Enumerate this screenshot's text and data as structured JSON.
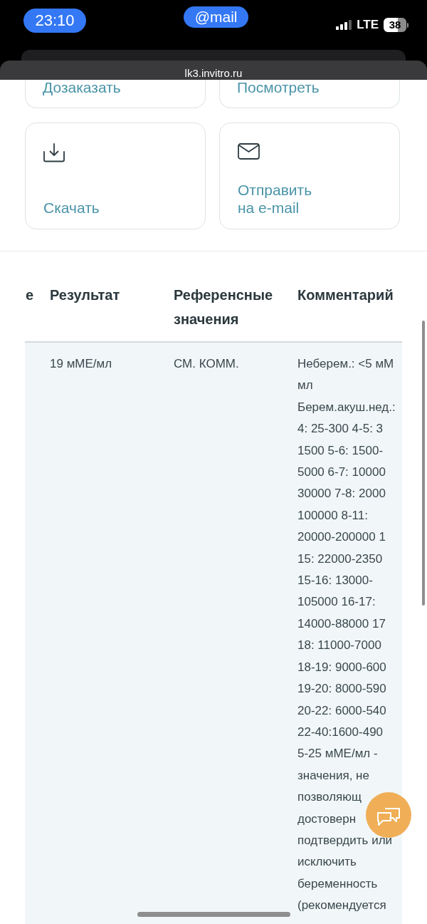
{
  "status_bar": {
    "time": "23:10",
    "app_pill": "@mail",
    "network": "LTE",
    "battery": "38"
  },
  "browser": {
    "url": "lk3.invitro.ru"
  },
  "action_rows": [
    {
      "cut_off": true,
      "items": [
        {
          "label": "Дозаказать"
        },
        {
          "label": "Посмотреть"
        }
      ]
    },
    {
      "cut_off": false,
      "items": [
        {
          "label": "Скачать",
          "kind": "download"
        },
        {
          "label": "Отправить на e-mail",
          "kind": "email"
        }
      ]
    }
  ],
  "table": {
    "columns": [
      "е",
      "Результат",
      "Референсные значения",
      "Комментарий"
    ],
    "rows": [
      {
        "result": "19 мМЕ/мл",
        "reference": "СМ. КОММ.",
        "comment_lines": [
          "Неберем.: <5 мМ",
          "мл",
          "Берем.акуш.нед.:",
          "4: 25-300 4-5: 3",
          "1500 5-6: 1500-",
          "5000 6-7: 10000",
          "30000 7-8: 2000",
          "100000 8-11:",
          "20000-200000 1",
          "15: 22000-2350",
          "15-16: 13000-",
          "105000 16-17:",
          "14000-88000 17",
          "18: 11000-7000",
          "18-19: 9000-600",
          "19-20: 8000-590",
          "20-22: 6000-540",
          "22-40:1600-490",
          "5-25 мМЕ/мл -",
          "значения, не",
          "позволяющ",
          "достоверн",
          "подтвердить или",
          "исключить",
          "беременность",
          "(рекомендуется"
        ]
      }
    ]
  }
}
